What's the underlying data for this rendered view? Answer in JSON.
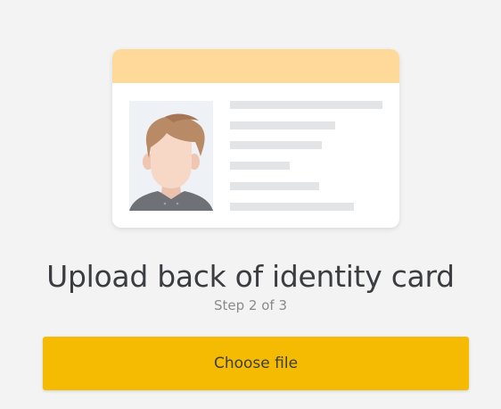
{
  "illustration": {
    "name": "identity-card-illustration",
    "colors": {
      "card": "#ffffff",
      "header": "#fed99a",
      "photo_background": "#eef1f5",
      "text_lines": "#e3e4e6",
      "hair": "#b98a66",
      "skin": "#f7d7c6",
      "shirt": "#6e7176"
    }
  },
  "heading": {
    "title": "Upload back of identity card",
    "step": "Step 2 of 3"
  },
  "actions": {
    "choose_file_label": "Choose file",
    "accent": "#f4bb02"
  }
}
